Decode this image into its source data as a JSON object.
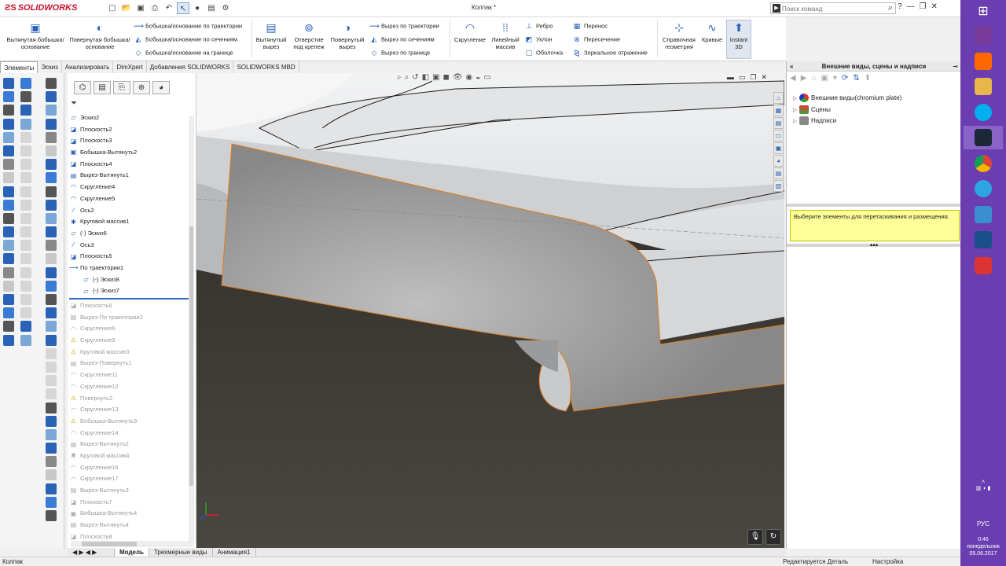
{
  "app": {
    "brand": "SOLIDWORKS",
    "doc_title": "Колпак *"
  },
  "search": {
    "placeholder": "Поиск команд"
  },
  "ribbon": {
    "extrude_boss": "Вытянутая бобышка/основание",
    "revolve_boss": "Повернутая бобышка/основание",
    "sweep_boss": "Бобышка/основание по траектории",
    "loft_boss": "Бобышка/основание по сечениям",
    "boundary_boss": "Бобышка/основание на границе",
    "extrude_cut": "Вытянутый вырез",
    "hole_wizard": "Отверстие под крепеж",
    "revolve_cut": "Повернутый вырез",
    "sweep_cut": "Вырез по траектории",
    "loft_cut": "Вырез по сечениям",
    "boundary_cut": "Вырез по границе",
    "fillet": "Скругление",
    "linear_pattern": "Линейный массив",
    "rib": "Ребро",
    "draft": "Уклон",
    "shell": "Оболочка",
    "wrap": "Перенос",
    "intersect": "Пересечение",
    "mirror": "Зеркальное отражение",
    "ref_geometry": "Справочная геометрия",
    "curves": "Кривые",
    "instant3d": "Instant 3D"
  },
  "cm_tabs": [
    "Элементы",
    "Эскиз",
    "Анализировать",
    "DimXpert",
    "Добавления SOLIDWORKS",
    "SOLIDWORKS MBD"
  ],
  "tree": [
    {
      "label": "Эскиз2",
      "icon": "sketch",
      "state": "normal"
    },
    {
      "label": "Плоскость2",
      "icon": "plane",
      "state": "normal"
    },
    {
      "label": "Плоскость3",
      "icon": "plane",
      "state": "normal"
    },
    {
      "label": "Бобышка-Вытянуть2",
      "icon": "extrude",
      "state": "normal"
    },
    {
      "label": "Плоскость4",
      "icon": "plane",
      "state": "normal"
    },
    {
      "label": "Вырез-Вытянуть1",
      "icon": "cut",
      "state": "normal"
    },
    {
      "label": "Скругление4",
      "icon": "fillet",
      "state": "normal"
    },
    {
      "label": "Скругление5",
      "icon": "fillet",
      "state": "normal"
    },
    {
      "label": "Ось2",
      "icon": "axis",
      "state": "normal"
    },
    {
      "label": "Круговой массив1",
      "icon": "pattern",
      "state": "normal"
    },
    {
      "label": "(-) Эскиз6",
      "icon": "sketch",
      "state": "normal"
    },
    {
      "label": "Ось3",
      "icon": "axis",
      "state": "normal"
    },
    {
      "label": "Плоскость5",
      "icon": "plane",
      "state": "normal"
    },
    {
      "label": "По траектории1",
      "icon": "sweep",
      "state": "normal"
    },
    {
      "label": "(-) Эскиз8",
      "icon": "sketch",
      "state": "child"
    },
    {
      "label": "(-) Эскиз7",
      "icon": "sketch",
      "state": "child"
    },
    {
      "label": "Плоскость6",
      "icon": "plane",
      "state": "dim"
    },
    {
      "label": "Вырез-По траектории2",
      "icon": "cut",
      "state": "dim"
    },
    {
      "label": "Скругление6",
      "icon": "fillet",
      "state": "dim"
    },
    {
      "label": "Скругление9",
      "icon": "warning",
      "state": "dim"
    },
    {
      "label": "Круговой массив3",
      "icon": "warning",
      "state": "dim"
    },
    {
      "label": "Вырез-Повернуть1",
      "icon": "cut",
      "state": "dim"
    },
    {
      "label": "Скругление11",
      "icon": "fillet",
      "state": "dim"
    },
    {
      "label": "Скругление12",
      "icon": "fillet",
      "state": "dim"
    },
    {
      "label": "Повернуть2",
      "icon": "warning",
      "state": "dim"
    },
    {
      "label": "Скругление13",
      "icon": "fillet",
      "state": "dim"
    },
    {
      "label": "Бобышка-Вытянуть3",
      "icon": "warning",
      "state": "dim"
    },
    {
      "label": "Скругление14",
      "icon": "fillet",
      "state": "dim"
    },
    {
      "label": "Вырез-Вытянуть2",
      "icon": "cut",
      "state": "dim"
    },
    {
      "label": "Круговой массив4",
      "icon": "pattern",
      "state": "dim"
    },
    {
      "label": "Скругление16",
      "icon": "fillet",
      "state": "dim"
    },
    {
      "label": "Скругление17",
      "icon": "fillet",
      "state": "dim"
    },
    {
      "label": "Вырез-Вытянуть3",
      "icon": "cut",
      "state": "dim"
    },
    {
      "label": "Плоскость7",
      "icon": "plane",
      "state": "dim"
    },
    {
      "label": "Бобышка-Вытянуть4",
      "icon": "extrude",
      "state": "dim"
    },
    {
      "label": "Вырез-Вытянуть4",
      "icon": "cut",
      "state": "dim"
    },
    {
      "label": "Плоскость8",
      "icon": "plane",
      "state": "dim"
    }
  ],
  "task_pane": {
    "title": "Внешние виды, сцены и надписи",
    "items": [
      "Внешние виды(chromium plate)",
      "Сцены",
      "Надписи"
    ],
    "hint": "Выберите элементы для перетаскивания и размещения."
  },
  "bottom_tabs": [
    "Модель",
    "Трехмерные виды",
    "Анимация1"
  ],
  "status": {
    "left": "Колпак",
    "editing": "Редактируется Деталь",
    "settings": "Настройка"
  },
  "taskbar": {
    "lang": "РУС",
    "time": "0:46",
    "day": "понедельник",
    "date": "05.06.2017",
    "apps": [
      "winrar-icon",
      "xiaomi-icon",
      "explorer-icon",
      "skype-icon",
      "steam-icon",
      "chrome-icon",
      "telegram-icon",
      "control-panel-icon",
      "monitor-icon",
      "solidworks-2016-icon"
    ]
  },
  "colors": {
    "accent": "#2a62b5",
    "taskbar": "#6a3eb0",
    "hint_bg": "#ffff99",
    "edge_highlight": "#e07b1a"
  }
}
